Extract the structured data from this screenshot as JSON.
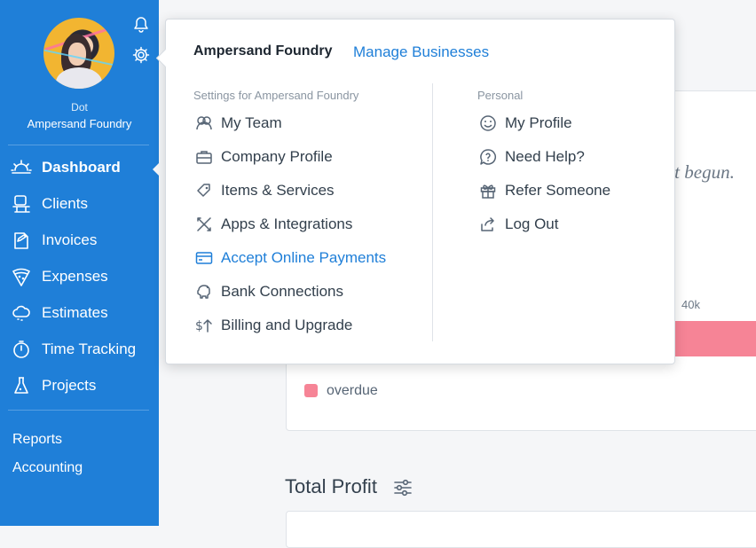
{
  "sidebar": {
    "user_name": "Dot",
    "business": "Ampersand Foundry",
    "nav": [
      {
        "label": "Dashboard",
        "icon": "sun-icon"
      },
      {
        "label": "Clients",
        "icon": "clients-icon"
      },
      {
        "label": "Invoices",
        "icon": "invoice-icon"
      },
      {
        "label": "Expenses",
        "icon": "pizza-icon"
      },
      {
        "label": "Estimates",
        "icon": "cloud-icon"
      },
      {
        "label": "Time Tracking",
        "icon": "stopwatch-icon"
      },
      {
        "label": "Projects",
        "icon": "flask-icon"
      }
    ],
    "links": [
      "Reports",
      "Accounting"
    ],
    "active": "Dashboard",
    "color": "#1f7fd8"
  },
  "background": {
    "italic_text": "st begun.",
    "axis_tick": "40k",
    "legend_label": "overdue",
    "legend_color": "#f68496",
    "section_title": "Total Profit"
  },
  "popover": {
    "business_title": "Ampersand Foundry",
    "manage_link": "Manage Businesses",
    "settings_label": "Settings for Ampersand Foundry",
    "settings_items": [
      {
        "label": "My Team",
        "icon": "team-icon"
      },
      {
        "label": "Company Profile",
        "icon": "briefcase-icon"
      },
      {
        "label": "Items & Services",
        "icon": "tag-icon"
      },
      {
        "label": "Apps & Integrations",
        "icon": "tools-icon"
      },
      {
        "label": "Accept Online Payments",
        "icon": "credit-card-icon",
        "highlight": true
      },
      {
        "label": "Bank Connections",
        "icon": "piggy-bank-icon"
      },
      {
        "label": "Billing and Upgrade",
        "icon": "dollar-arrow-icon"
      }
    ],
    "personal_label": "Personal",
    "personal_items": [
      {
        "label": "My Profile",
        "icon": "smiley-icon"
      },
      {
        "label": "Need Help?",
        "icon": "help-bubble-icon"
      },
      {
        "label": "Refer Someone",
        "icon": "gift-icon"
      },
      {
        "label": "Log Out",
        "icon": "logout-icon"
      }
    ],
    "link_color": "#1f7fd8"
  }
}
